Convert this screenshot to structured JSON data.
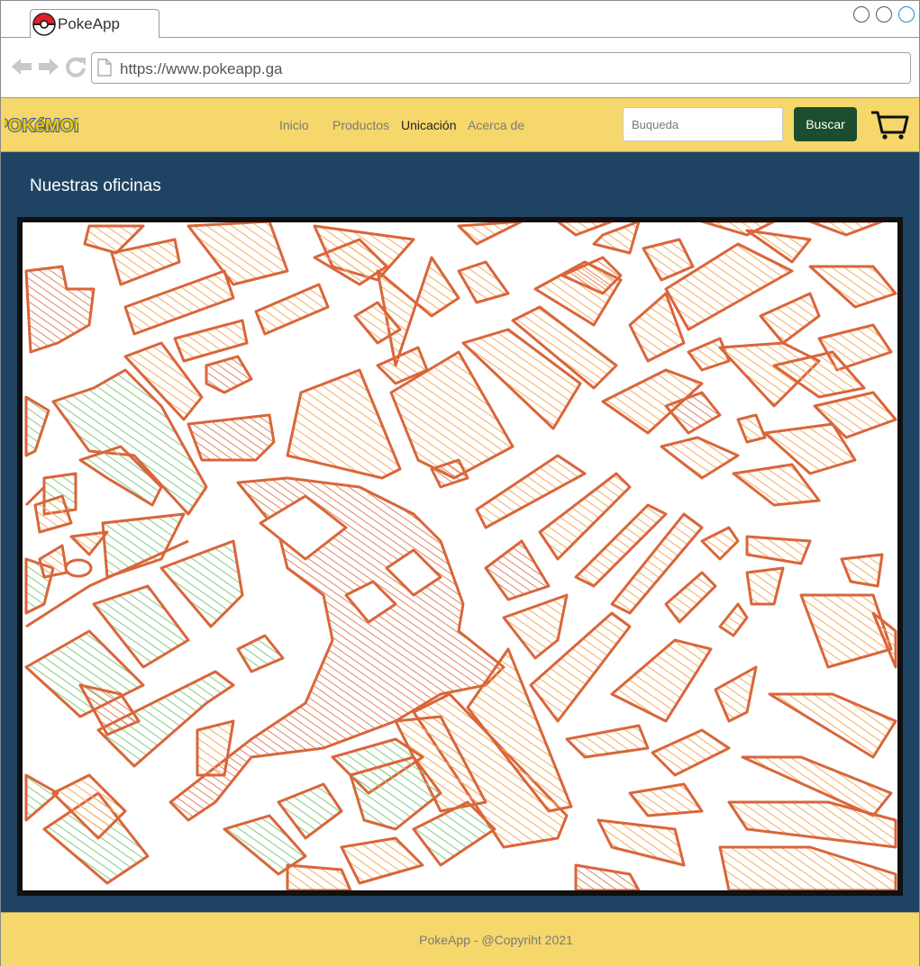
{
  "browser": {
    "tab_title": "PokeApp",
    "url": "https://www.pokeapp.ga",
    "icons": [
      "back-arrow-icon",
      "forward-arrow-icon",
      "reload-icon",
      "page-icon"
    ]
  },
  "header": {
    "logo_text": "POKéMON",
    "nav": [
      "Inicio",
      "Productos",
      "Unicación",
      "Acerca de"
    ],
    "active_nav": "Unicación",
    "search_placeholder": "Buqueda",
    "search_button": "Buscar",
    "cart_icon": "cart-icon"
  },
  "main": {
    "title": "Nuestras oficinas",
    "map_image": "city-map-sketch"
  },
  "footer": {
    "text": "PokeApp - @Copyriht 2021"
  },
  "colors": {
    "header_bg": "#f5d76b",
    "main_bg": "#1f4463",
    "search_button_bg": "#1b4d2e",
    "map_stroke": "#d9663a",
    "map_fill_orange": "#f5b26b",
    "map_fill_green": "#8fce8b"
  }
}
